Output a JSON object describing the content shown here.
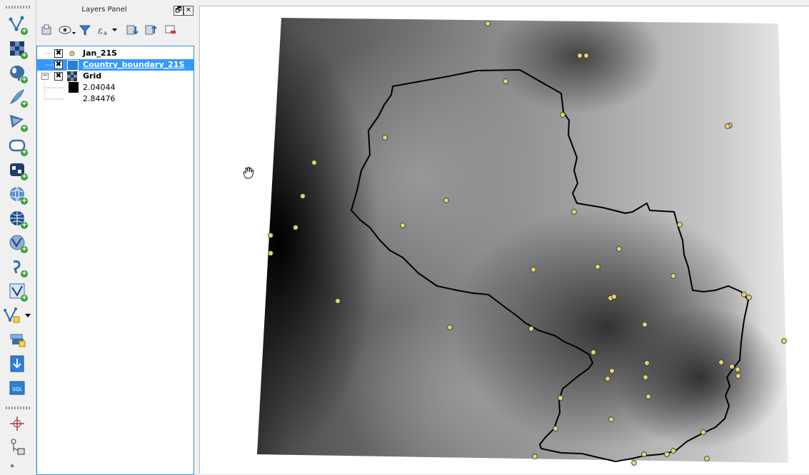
{
  "panel": {
    "title": "Layers Panel",
    "float_button": "🗗",
    "close_button": "✕"
  },
  "layers": [
    {
      "name": "Jan_21S",
      "checked": "✖",
      "type": "point-layer",
      "symbol_color": "#e6d56a"
    },
    {
      "name": "Country_boundary_21S",
      "checked": "✖",
      "type": "polygon-layer",
      "selected": true,
      "symbol_color": "#2a7fd4"
    },
    {
      "name": "Grid",
      "checked": "✖",
      "type": "raster-layer",
      "expand": "−"
    }
  ],
  "grid_legend": [
    {
      "label": "2.04044",
      "color": "#000000"
    },
    {
      "label": "2.84476",
      "color": "#ffffff"
    }
  ],
  "left_toolbar_icons": [
    "add-vector-layer-icon",
    "add-raster-layer-icon",
    "add-postgis-layer-icon",
    "add-spatialite-layer-icon",
    "add-mssql-layer-icon",
    "add-oracle-layer-icon",
    "add-db2-layer-icon",
    "add-wms-layer-icon",
    "add-wcs-layer-icon",
    "add-wfs-layer-icon",
    "add-delimited-text-layer-icon",
    "add-virtual-layer-icon",
    "new-shapefile-layer-icon",
    "new-spatialite-layer-icon",
    "new-geopackage-icon",
    "db-manager-icon",
    "georeferencer-icon",
    "topology-checker-icon"
  ],
  "colors": {
    "selection": "#3399ff",
    "point_fill": "#e6d56a",
    "boundary": "#000000"
  }
}
